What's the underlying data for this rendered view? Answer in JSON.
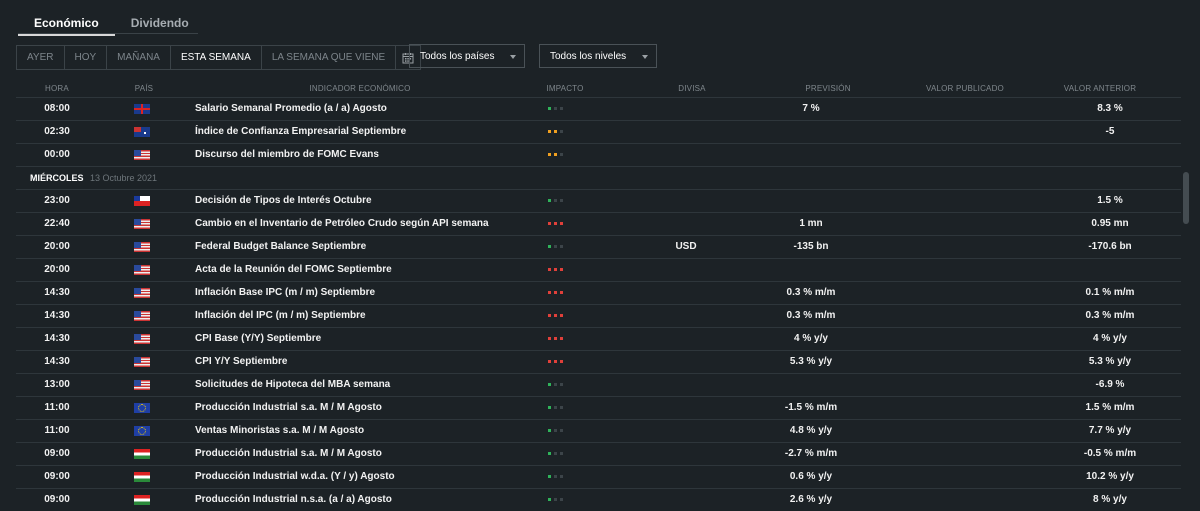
{
  "tabs": [
    "Económico",
    "Dividendo"
  ],
  "day_buttons": [
    "AYER",
    "HOY",
    "MAÑANA",
    "ESTA SEMANA",
    "LA SEMANA QUE VIENE"
  ],
  "active_day": "ESTA SEMANA",
  "country_filter": "Todos los países",
  "level_filter": "Todos los niveles",
  "headers": {
    "hora": "HORA",
    "pais": "PAÍS",
    "indicador": "INDICADOR ECONÓMICO",
    "impacto": "IMPACTO",
    "divisa": "DIVISA",
    "prevision": "PREVISIÓN",
    "publicado": "VALOR PUBLICADO",
    "anterior": "VALOR ANTERIOR"
  },
  "colors": {
    "impact_high": "#e0403a",
    "impact_medium": "#f0a020",
    "impact_low": "#2fb35a",
    "impact_off": "#3c4449"
  },
  "rows": [
    {
      "type": "event",
      "time": "08:00",
      "flag": "flag-gb",
      "event": "Salario Semanal Promedio (a / a) Agosto",
      "impact": "low",
      "currency": "",
      "forecast": "7 %",
      "published": "",
      "previous": "8.3 %"
    },
    {
      "type": "event",
      "time": "02:30",
      "flag": "flag-au",
      "event": "Índice de Confianza Empresarial Septiembre",
      "impact": "medium",
      "currency": "",
      "forecast": "",
      "published": "",
      "previous": "-5"
    },
    {
      "type": "event",
      "time": "00:00",
      "flag": "flag-us",
      "event": "Discurso del miembro de FOMC Evans",
      "impact": "medium",
      "currency": "",
      "forecast": "",
      "published": "",
      "previous": ""
    },
    {
      "type": "day",
      "day": "MIÉRCOLES",
      "date": "13 Octubre 2021"
    },
    {
      "type": "event",
      "time": "23:00",
      "flag": "flag-cl",
      "event": "Decisión de Tipos de Interés Octubre",
      "impact": "low",
      "currency": "",
      "forecast": "",
      "published": "",
      "previous": "1.5 %"
    },
    {
      "type": "event",
      "time": "22:40",
      "flag": "flag-us",
      "event": "Cambio en el Inventario de Petróleo Crudo según API semana",
      "impact": "high",
      "currency": "",
      "forecast": "1 mn",
      "published": "",
      "previous": "0.95 mn"
    },
    {
      "type": "event",
      "time": "20:00",
      "flag": "flag-us",
      "event": "Federal Budget Balance Septiembre",
      "impact": "low",
      "currency": "USD",
      "forecast": "-135 bn",
      "published": "",
      "previous": "-170.6 bn"
    },
    {
      "type": "event",
      "time": "20:00",
      "flag": "flag-us",
      "event": "Acta de la Reunión del FOMC Septiembre",
      "impact": "high",
      "currency": "",
      "forecast": "",
      "published": "",
      "previous": ""
    },
    {
      "type": "event",
      "time": "14:30",
      "flag": "flag-us",
      "event": "Inflación Base IPC (m / m) Septiembre",
      "impact": "high",
      "currency": "",
      "forecast": "0.3 % m/m",
      "published": "",
      "previous": "0.1 % m/m"
    },
    {
      "type": "event",
      "time": "14:30",
      "flag": "flag-us",
      "event": "Inflación del IPC (m / m) Septiembre",
      "impact": "high",
      "currency": "",
      "forecast": "0.3 % m/m",
      "published": "",
      "previous": "0.3 % m/m"
    },
    {
      "type": "event",
      "time": "14:30",
      "flag": "flag-us",
      "event": "CPI Base (Y/Y) Septiembre",
      "impact": "high",
      "currency": "",
      "forecast": "4 % y/y",
      "published": "",
      "previous": "4 % y/y"
    },
    {
      "type": "event",
      "time": "14:30",
      "flag": "flag-us",
      "event": "CPI Y/Y Septiembre",
      "impact": "high",
      "currency": "",
      "forecast": "5.3 % y/y",
      "published": "",
      "previous": "5.3 % y/y"
    },
    {
      "type": "event",
      "time": "13:00",
      "flag": "flag-us",
      "event": "Solicitudes de Hipoteca del MBA semana",
      "impact": "low",
      "currency": "",
      "forecast": "",
      "published": "",
      "previous": "-6.9 %"
    },
    {
      "type": "event",
      "time": "11:00",
      "flag": "flag-eu",
      "event": "Producción Industrial s.a. M / M Agosto",
      "impact": "low",
      "currency": "",
      "forecast": "-1.5 % m/m",
      "published": "",
      "previous": "1.5 % m/m"
    },
    {
      "type": "event",
      "time": "11:00",
      "flag": "flag-eu",
      "event": "Ventas Minoristas s.a. M / M Agosto",
      "impact": "low",
      "currency": "",
      "forecast": "4.8 % y/y",
      "published": "",
      "previous": "7.7 % y/y"
    },
    {
      "type": "event",
      "time": "09:00",
      "flag": "flag-hu",
      "event": "Producción Industrial s.a. M / M Agosto",
      "impact": "low",
      "currency": "",
      "forecast": "-2.7 % m/m",
      "published": "",
      "previous": "-0.5 % m/m"
    },
    {
      "type": "event",
      "time": "09:00",
      "flag": "flag-hu",
      "event": "Producción Industrial w.d.a. (Y / y) Agosto",
      "impact": "low",
      "currency": "",
      "forecast": "0.6 % y/y",
      "published": "",
      "previous": "10.2 % y/y"
    },
    {
      "type": "event",
      "time": "09:00",
      "flag": "flag-hu",
      "event": "Producción Industrial n.s.a. (a / a) Agosto",
      "impact": "low",
      "currency": "",
      "forecast": "2.6 % y/y",
      "published": "",
      "previous": "8 % y/y"
    }
  ]
}
